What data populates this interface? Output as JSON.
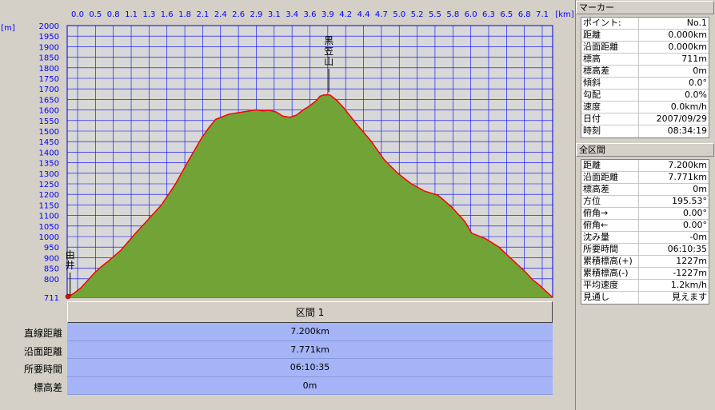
{
  "chart_data": {
    "type": "area",
    "x_unit": "[km]",
    "y_unit": "[m]",
    "xlim": [
      0,
      7.2
    ],
    "ylim": [
      711,
      2000
    ],
    "x_ticks": [
      "0.0",
      "0.5",
      "0.8",
      "1.1",
      "1.3",
      "1.6",
      "1.8",
      "2.1",
      "2.4",
      "2.6",
      "2.9",
      "3.1",
      "3.4",
      "3.6",
      "3.9",
      "4.2",
      "4.4",
      "4.7",
      "5.0",
      "5.2",
      "5.5",
      "5.8",
      "6.0",
      "6.3",
      "6.5",
      "6.8",
      "7.1"
    ],
    "y_ticks": [
      2000,
      1950,
      1900,
      1850,
      1800,
      1750,
      1700,
      1650,
      1600,
      1550,
      1500,
      1450,
      1400,
      1350,
      1300,
      1250,
      1200,
      1150,
      1100,
      1050,
      1000,
      950,
      900,
      850,
      800,
      711
    ],
    "grid": true,
    "series": [
      {
        "x": [
          0.0,
          0.1,
          0.2,
          0.3,
          0.4,
          0.5,
          0.6,
          0.8,
          1.0,
          1.2,
          1.4,
          1.6,
          1.8,
          2.0,
          2.1,
          2.2,
          2.4,
          2.6,
          2.8,
          2.9,
          3.0,
          3.1,
          3.2,
          3.3,
          3.4,
          3.5,
          3.6,
          3.7,
          3.75,
          3.8,
          3.85,
          3.9,
          4.0,
          4.1,
          4.2,
          4.3,
          4.5,
          4.7,
          4.9,
          5.1,
          5.3,
          5.5,
          5.7,
          5.9,
          6.0,
          6.2,
          6.4,
          6.6,
          6.8,
          6.9,
          7.0,
          7.1,
          7.2
        ],
        "y": [
          711,
          730,
          755,
          790,
          825,
          855,
          880,
          935,
          1010,
          1080,
          1150,
          1245,
          1360,
          1470,
          1515,
          1555,
          1580,
          1590,
          1600,
          1595,
          1598,
          1590,
          1570,
          1565,
          1575,
          1600,
          1620,
          1645,
          1665,
          1670,
          1672,
          1670,
          1645,
          1610,
          1570,
          1530,
          1455,
          1365,
          1300,
          1250,
          1215,
          1195,
          1140,
          1070,
          1015,
          990,
          950,
          890,
          830,
          795,
          770,
          740,
          711
        ],
        "color": "#ff0000",
        "fill": "#72a337"
      }
    ],
    "annotations": [
      {
        "label": "黒笠山",
        "x": 3.88,
        "y": 1672
      },
      {
        "label": "由井",
        "x": 0.02,
        "y": 711
      }
    ]
  },
  "section": {
    "label": "区間 1"
  },
  "summary": [
    {
      "label": "直線距離",
      "value": "7.200km"
    },
    {
      "label": "沿面距離",
      "value": "7.771km"
    },
    {
      "label": "所要時間",
      "value": "06:10:35"
    },
    {
      "label": "標高差",
      "value": "0m"
    }
  ],
  "marker": {
    "title": "マーカー",
    "rows": [
      {
        "k": "ポイント:",
        "v": "No.1"
      },
      {
        "k": "距離",
        "v": "0.000km"
      },
      {
        "k": "沿面距離",
        "v": "0.000km"
      },
      {
        "k": "標高",
        "v": "711m"
      },
      {
        "k": "標高差",
        "v": "0m"
      },
      {
        "k": "傾斜",
        "v": "0.0°"
      },
      {
        "k": "勾配",
        "v": "0.0%"
      },
      {
        "k": "速度",
        "v": "0.0km/h"
      },
      {
        "k": "日付",
        "v": "2007/09/29"
      },
      {
        "k": "時刻",
        "v": "08:34:19"
      }
    ]
  },
  "total": {
    "title": "全区間",
    "rows": [
      {
        "k": "距離",
        "v": "7.200km"
      },
      {
        "k": "沿面距離",
        "v": "7.771km"
      },
      {
        "k": "標高差",
        "v": "0m"
      },
      {
        "k": "方位",
        "v": "195.53°"
      },
      {
        "k": "俯角→",
        "v": "0.00°"
      },
      {
        "k": "俯角←",
        "v": "0.00°"
      },
      {
        "k": "沈み量",
        "v": "-0m"
      },
      {
        "k": "所要時間",
        "v": "06:10:35"
      },
      {
        "k": "累積標高(+)",
        "v": "1227m"
      },
      {
        "k": "累積標高(-)",
        "v": "-1227m"
      },
      {
        "k": "平均速度",
        "v": "1.2km/h"
      },
      {
        "k": "見通し",
        "v": "見えます"
      }
    ]
  }
}
